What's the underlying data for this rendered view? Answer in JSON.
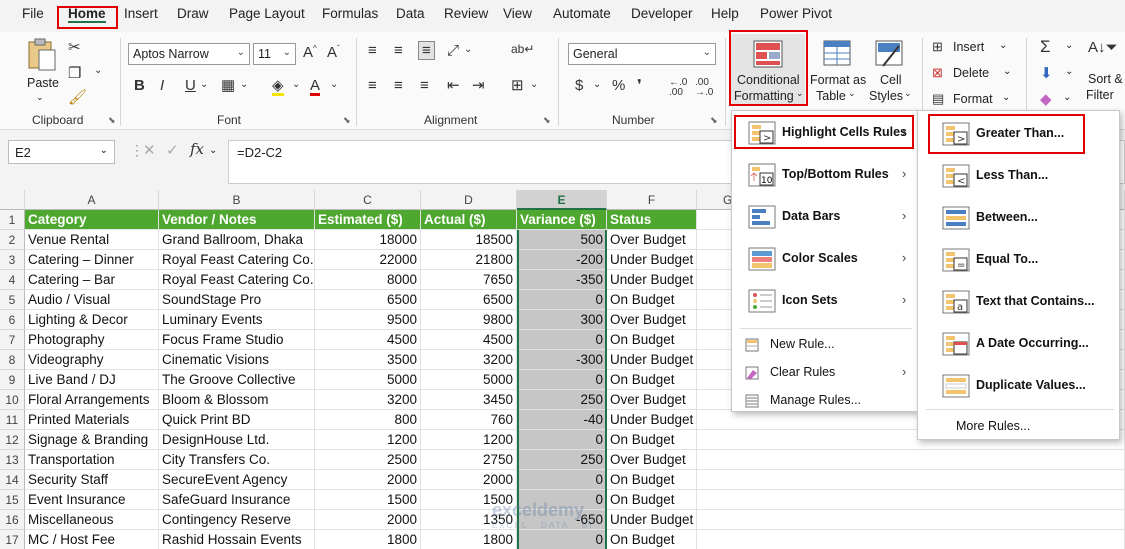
{
  "menubar": {
    "tabs": [
      "File",
      "Home",
      "Insert",
      "Draw",
      "Page Layout",
      "Formulas",
      "Data",
      "Review",
      "View",
      "Automate",
      "Developer",
      "Help",
      "Power Pivot"
    ]
  },
  "ribbon": {
    "paste_label": "Paste",
    "font_name": "Aptos Narrow",
    "font_size": "11",
    "number_format": "General",
    "conditional_formatting": [
      "Conditional",
      "Formatting"
    ],
    "format_as_table": [
      "Format as",
      "Table"
    ],
    "cell_styles": [
      "Cell",
      "Styles"
    ],
    "insert_label": "Insert",
    "delete_label": "Delete",
    "format_label": "Format",
    "sort_filter": [
      "Sort &",
      "Filter"
    ],
    "groups": {
      "clipboard": "Clipboard",
      "font": "Font",
      "alignment": "Alignment",
      "number": "Number"
    }
  },
  "formula_bar": {
    "name_box": "E2",
    "fx": "fx",
    "formula": "=D2-C2"
  },
  "grid": {
    "columns": [
      "A",
      "B",
      "C",
      "D",
      "E",
      "F",
      "G"
    ],
    "rows": [
      "1",
      "2",
      "3",
      "4",
      "5",
      "6",
      "7",
      "8",
      "9",
      "10",
      "11",
      "12",
      "13",
      "14",
      "15",
      "16",
      "17"
    ],
    "header": [
      "Category",
      "Vendor / Notes",
      "Estimated ($)",
      "Actual ($)",
      "Variance ($)",
      "Status"
    ],
    "data": [
      [
        "Venue Rental",
        "Grand Ballroom, Dhaka",
        "18000",
        "18500",
        "500",
        "Over Budget"
      ],
      [
        "Catering – Dinner",
        "Royal Feast Catering Co.",
        "22000",
        "21800",
        "-200",
        "Under Budget"
      ],
      [
        "Catering – Bar",
        "Royal Feast Catering Co.",
        "8000",
        "7650",
        "-350",
        "Under Budget"
      ],
      [
        "Audio / Visual",
        "SoundStage Pro",
        "6500",
        "6500",
        "0",
        "On Budget"
      ],
      [
        "Lighting & Decor",
        "Luminary Events",
        "9500",
        "9800",
        "300",
        "Over Budget"
      ],
      [
        "Photography",
        "Focus Frame Studio",
        "4500",
        "4500",
        "0",
        "On Budget"
      ],
      [
        "Videography",
        "Cinematic Visions",
        "3500",
        "3200",
        "-300",
        "Under Budget"
      ],
      [
        "Live Band / DJ",
        "The Groove Collective",
        "5000",
        "5000",
        "0",
        "On Budget"
      ],
      [
        "Floral Arrangements",
        "Bloom & Blossom",
        "3200",
        "3450",
        "250",
        "Over Budget"
      ],
      [
        "Printed Materials",
        "Quick Print BD",
        "800",
        "760",
        "-40",
        "Under Budget"
      ],
      [
        "Signage & Branding",
        "DesignHouse Ltd.",
        "1200",
        "1200",
        "0",
        "On Budget"
      ],
      [
        "Transportation",
        "City Transfers Co.",
        "2500",
        "2750",
        "250",
        "Over Budget"
      ],
      [
        "Security Staff",
        "SecureEvent Agency",
        "2000",
        "2000",
        "0",
        "On Budget"
      ],
      [
        "Event Insurance",
        "SafeGuard Insurance",
        "1500",
        "1500",
        "0",
        "On Budget"
      ],
      [
        "Miscellaneous",
        "Contingency Reserve",
        "2000",
        "1350",
        "-650",
        "Under Budget"
      ],
      [
        "MC / Host Fee",
        "Rashid Hossain Events",
        "1800",
        "1800",
        "0",
        "On Budget"
      ]
    ]
  },
  "cf_menu": {
    "items": [
      {
        "label": "Highlight Cells Rules",
        "icon": "highlight-cells-icon"
      },
      {
        "label": "Top/Bottom Rules",
        "icon": "top-bottom-icon"
      },
      {
        "label": "Data Bars",
        "icon": "data-bars-icon"
      },
      {
        "label": "Color Scales",
        "icon": "color-scales-icon"
      },
      {
        "label": "Icon Sets",
        "icon": "icon-sets-icon"
      }
    ],
    "small_items": [
      {
        "label": "New Rule...",
        "icon": "new-rule-icon"
      },
      {
        "label": "Clear Rules",
        "icon": "clear-rules-icon"
      },
      {
        "label": "Manage Rules...",
        "icon": "manage-rules-icon"
      }
    ]
  },
  "hcr_menu": {
    "items": [
      {
        "label": "Greater Than...",
        "icon": "greater-than-icon"
      },
      {
        "label": "Less Than...",
        "icon": "less-than-icon"
      },
      {
        "label": "Between...",
        "icon": "between-icon"
      },
      {
        "label": "Equal To...",
        "icon": "equal-to-icon"
      },
      {
        "label": "Text that Contains...",
        "icon": "text-contains-icon"
      },
      {
        "label": "A Date Occurring...",
        "icon": "date-occurring-icon"
      },
      {
        "label": "Duplicate Values...",
        "icon": "duplicate-values-icon"
      }
    ],
    "more_rules": "More Rules..."
  },
  "watermark": {
    "name": "exceldemy",
    "tagline": "EXCEL · DATA · BI"
  },
  "colors": {
    "header_green": "#4ea72e",
    "accent": "#217346",
    "highlight_red": "#e00000",
    "selection_gray": "#c6c6c6"
  }
}
